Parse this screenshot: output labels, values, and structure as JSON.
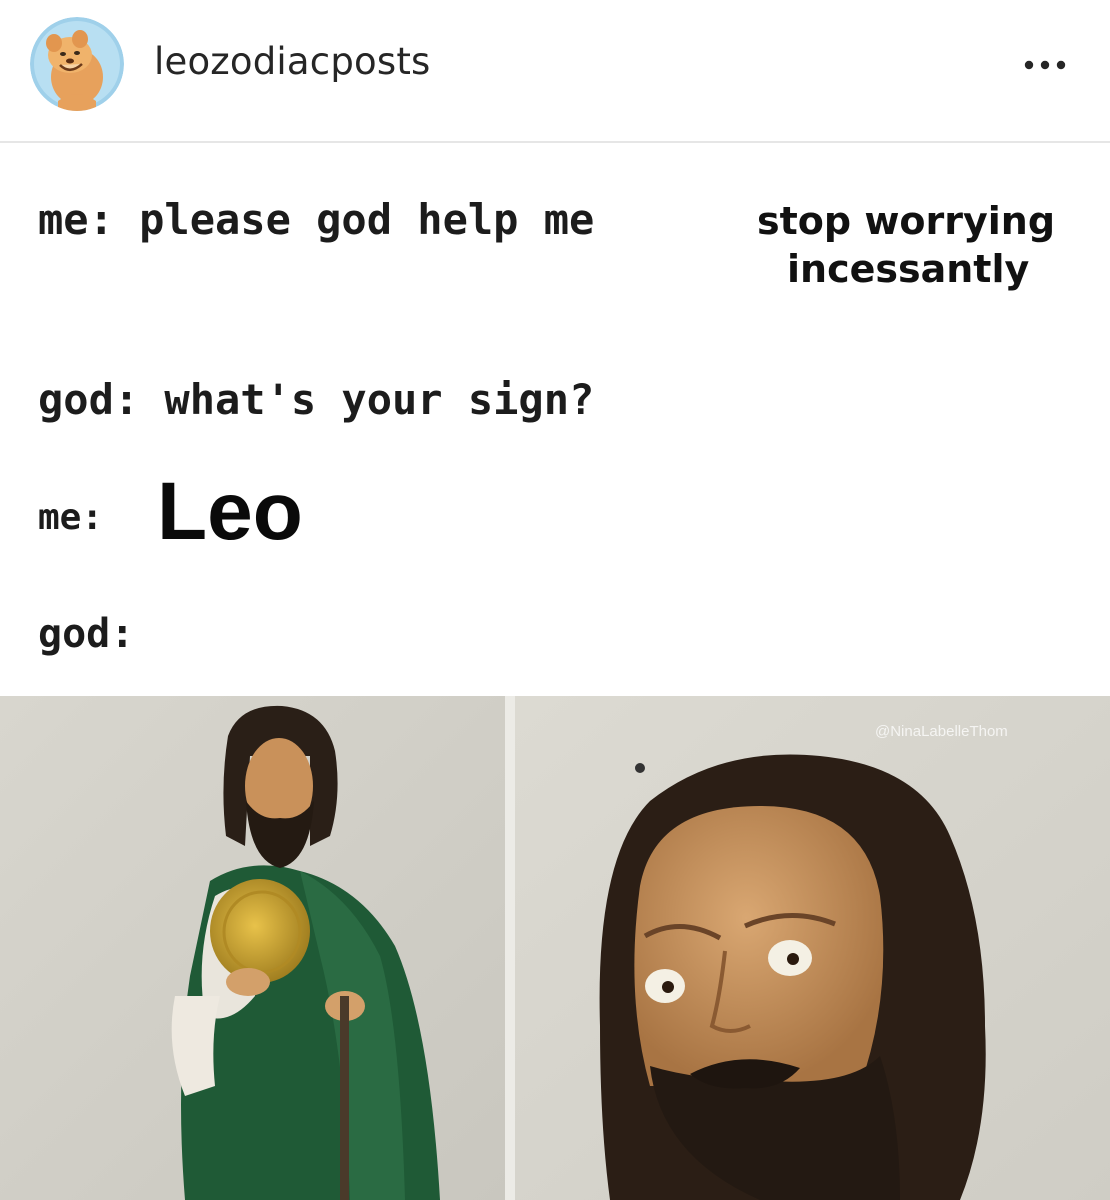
{
  "header": {
    "username": "leozodiacposts",
    "avatar_icon": "lion-cub-avatar",
    "more_icon": "more-horizontal-icon"
  },
  "meme": {
    "line1": "me: please god help me",
    "insert_line1": "stop worrying",
    "insert_line2": "incessantly",
    "line2": "god: what's your sign?",
    "line3_label": "me:",
    "line3_answer": "Leo",
    "line4": "god:",
    "watermark": "@NinaLabelleThom"
  },
  "colors": {
    "accent": "#262626",
    "divider": "#e6e6e6",
    "robe_green": "#1f5a36",
    "halo_gold": "#c9a227"
  }
}
